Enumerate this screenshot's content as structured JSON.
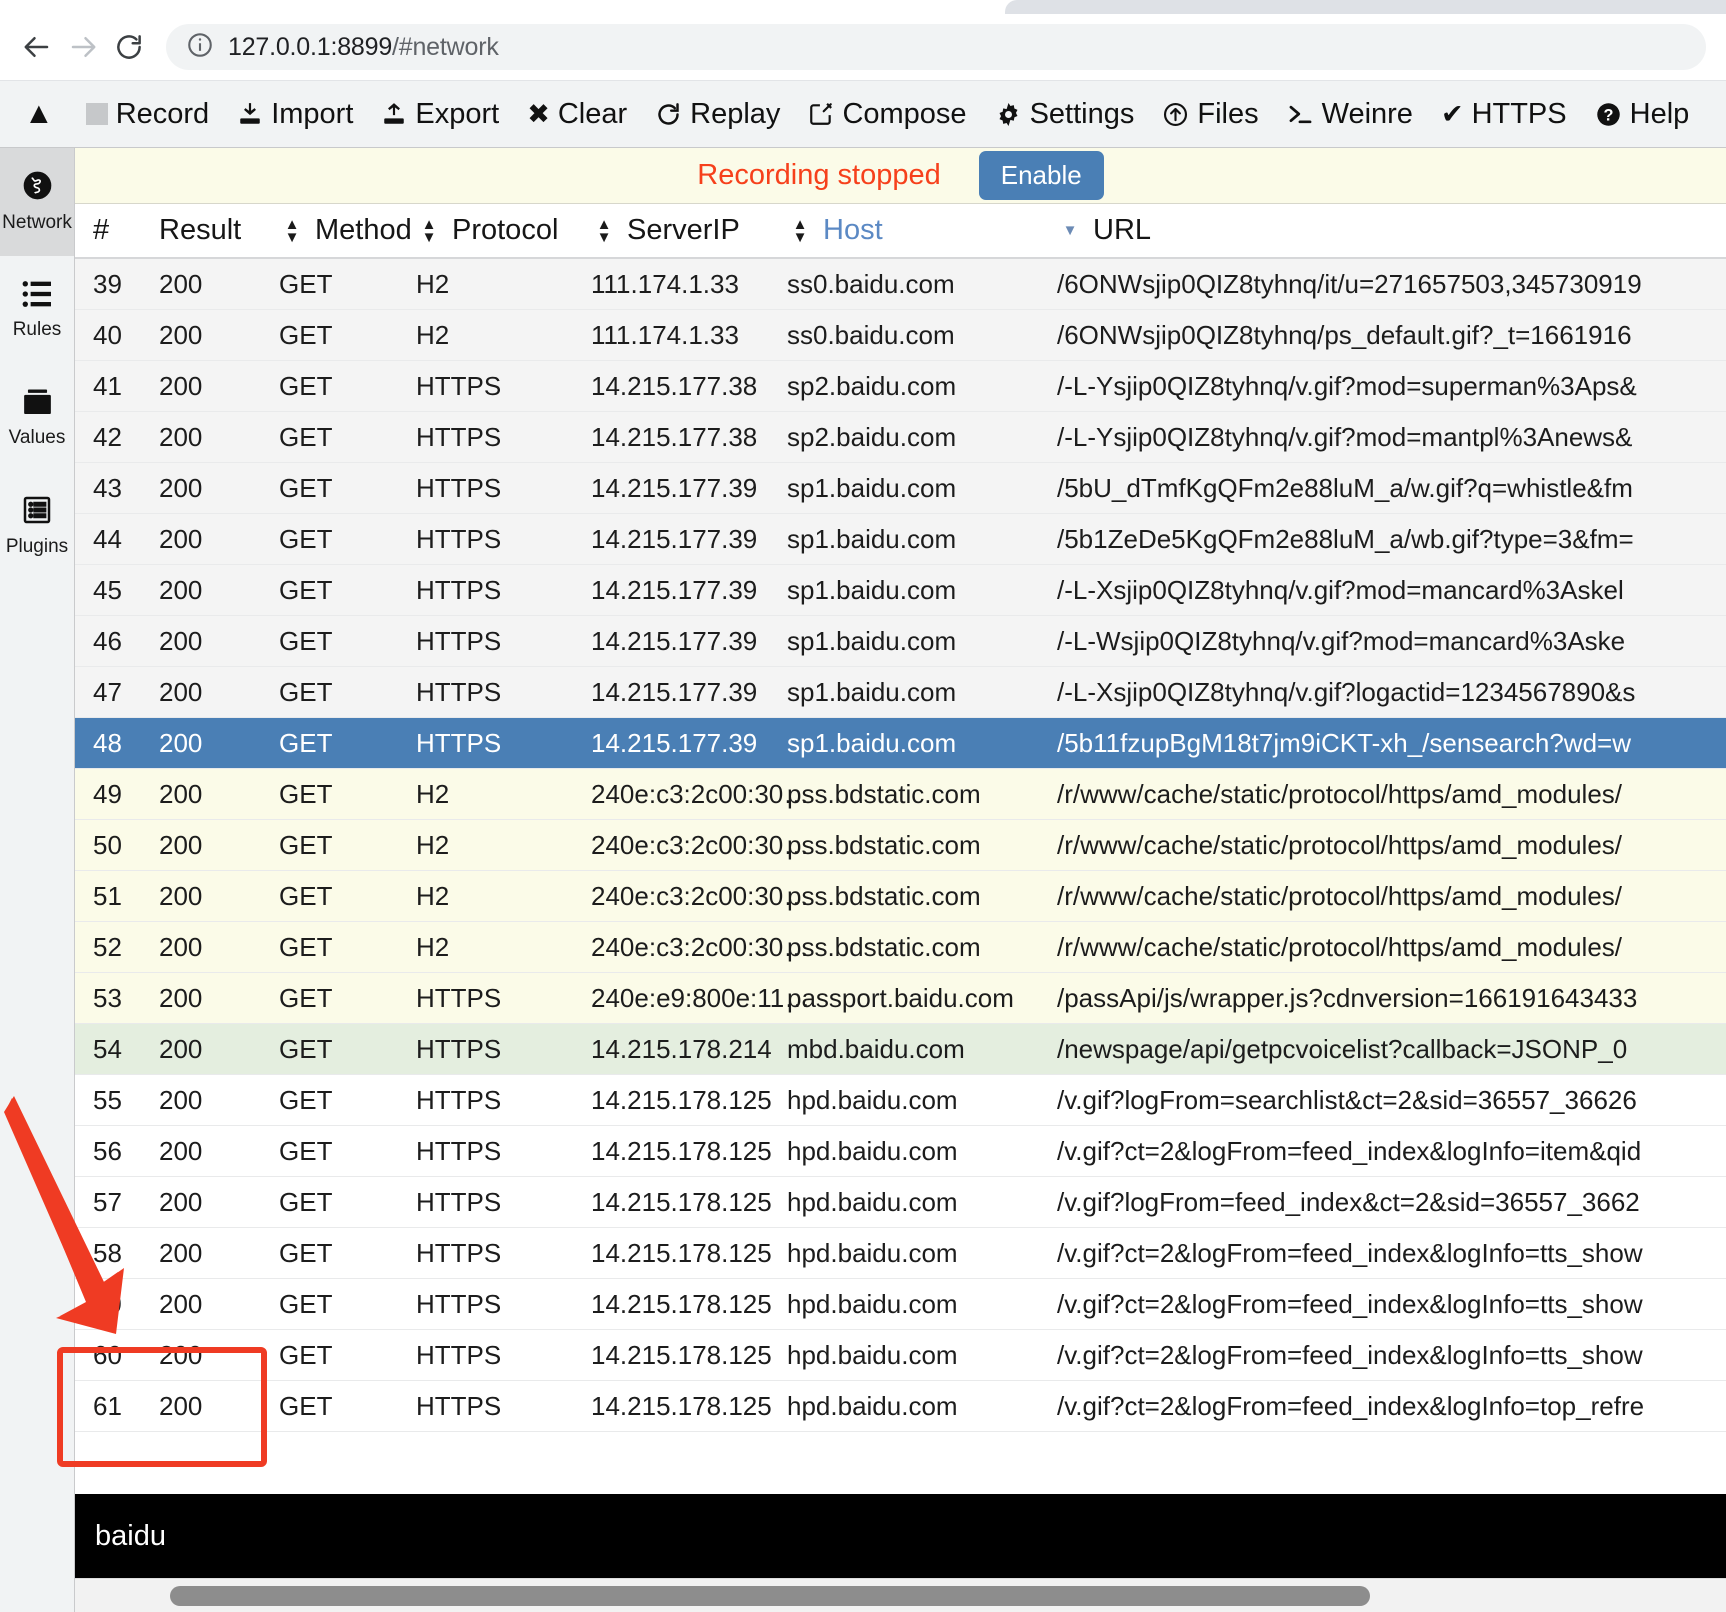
{
  "browser": {
    "back_icon": "back-arrow-icon",
    "forward_icon": "forward-arrow-icon",
    "reload_icon": "reload-icon",
    "info_icon": "site-info-icon",
    "url_main": "127.0.0.1:8899",
    "url_hash": "/#network"
  },
  "toolbar": {
    "collapse_caret": "▲",
    "items": [
      {
        "label": "Record",
        "icon": "stop-square-icon",
        "glyph": ""
      },
      {
        "label": "Import",
        "icon": "import-icon",
        "glyph": "↧"
      },
      {
        "label": "Export",
        "icon": "export-icon",
        "glyph": "↥"
      },
      {
        "label": "Clear",
        "icon": "close-x-icon",
        "glyph": "✖"
      },
      {
        "label": "Replay",
        "icon": "refresh-icon",
        "glyph": "↻"
      },
      {
        "label": "Compose",
        "icon": "compose-pencil-icon",
        "glyph": "✎"
      },
      {
        "label": "Settings",
        "icon": "gear-icon",
        "glyph": "⚙"
      },
      {
        "label": "Files",
        "icon": "upload-circle-icon",
        "glyph": "Ⓔ"
      },
      {
        "label": "Weinre",
        "icon": "terminal-icon",
        "glyph": "❯"
      },
      {
        "label": "HTTPS",
        "icon": "checkmark-icon",
        "glyph": "✔"
      },
      {
        "label": "Help",
        "icon": "question-circle-icon",
        "glyph": "?"
      }
    ]
  },
  "sidebar": {
    "items": [
      {
        "label": "Network",
        "icon": "globe-icon",
        "glyph": "🌐",
        "active": true
      },
      {
        "label": "Rules",
        "icon": "list-icon",
        "glyph": "☰",
        "active": false
      },
      {
        "label": "Values",
        "icon": "folder-icon",
        "glyph": "▬",
        "active": false
      },
      {
        "label": "Plugins",
        "icon": "plugins-icon",
        "glyph": "▤",
        "active": false
      }
    ]
  },
  "banner": {
    "message": "Recording stopped",
    "enable_label": "Enable",
    "message_color": "#f6401b",
    "button_color": "#4a7fb5"
  },
  "table": {
    "columns": [
      {
        "key": "num",
        "label": "#",
        "sortable": false,
        "sorted": false
      },
      {
        "key": "result",
        "label": "Result",
        "sortable": true,
        "sorted": false
      },
      {
        "key": "method",
        "label": "Method",
        "sortable": true,
        "sorted": false
      },
      {
        "key": "protocol",
        "label": "Protocol",
        "sortable": true,
        "sorted": false
      },
      {
        "key": "serverip",
        "label": "ServerIP",
        "sortable": true,
        "sorted": false
      },
      {
        "key": "host",
        "label": "Host",
        "sortable": true,
        "sorted": true
      },
      {
        "key": "url",
        "label": "URL",
        "sortable": false,
        "sorted": false
      }
    ],
    "rows": [
      {
        "num": "39",
        "result": "200",
        "method": "GET",
        "protocol": "H2",
        "serverip": "111.174.1.33",
        "host": "ss0.baidu.com",
        "url": "/6ONWsjip0QIZ8tyhnq/it/u=271657503,345730919",
        "style": "alt"
      },
      {
        "num": "40",
        "result": "200",
        "method": "GET",
        "protocol": "H2",
        "serverip": "111.174.1.33",
        "host": "ss0.baidu.com",
        "url": "/6ONWsjip0QIZ8tyhnq/ps_default.gif?_t=1661916",
        "style": "alt"
      },
      {
        "num": "41",
        "result": "200",
        "method": "GET",
        "protocol": "HTTPS",
        "serverip": "14.215.177.38",
        "host": "sp2.baidu.com",
        "url": "/-L-Ysjip0QIZ8tyhnq/v.gif?mod=superman%3Aps&",
        "style": "alt"
      },
      {
        "num": "42",
        "result": "200",
        "method": "GET",
        "protocol": "HTTPS",
        "serverip": "14.215.177.38",
        "host": "sp2.baidu.com",
        "url": "/-L-Ysjip0QIZ8tyhnq/v.gif?mod=mantpl%3Anews&",
        "style": "alt"
      },
      {
        "num": "43",
        "result": "200",
        "method": "GET",
        "protocol": "HTTPS",
        "serverip": "14.215.177.39",
        "host": "sp1.baidu.com",
        "url": "/5bU_dTmfKgQFm2e88luM_a/w.gif?q=whistle&fm",
        "style": "alt"
      },
      {
        "num": "44",
        "result": "200",
        "method": "GET",
        "protocol": "HTTPS",
        "serverip": "14.215.177.39",
        "host": "sp1.baidu.com",
        "url": "/5b1ZeDe5KgQFm2e88luM_a/wb.gif?type=3&fm=",
        "style": "alt"
      },
      {
        "num": "45",
        "result": "200",
        "method": "GET",
        "protocol": "HTTPS",
        "serverip": "14.215.177.39",
        "host": "sp1.baidu.com",
        "url": "/-L-Xsjip0QIZ8tyhnq/v.gif?mod=mancard%3Askel",
        "style": "alt"
      },
      {
        "num": "46",
        "result": "200",
        "method": "GET",
        "protocol": "HTTPS",
        "serverip": "14.215.177.39",
        "host": "sp1.baidu.com",
        "url": "/-L-Wsjip0QIZ8tyhnq/v.gif?mod=mancard%3Aske",
        "style": "alt"
      },
      {
        "num": "47",
        "result": "200",
        "method": "GET",
        "protocol": "HTTPS",
        "serverip": "14.215.177.39",
        "host": "sp1.baidu.com",
        "url": "/-L-Xsjip0QIZ8tyhnq/v.gif?logactid=1234567890&s",
        "style": "alt"
      },
      {
        "num": "48",
        "result": "200",
        "method": "GET",
        "protocol": "HTTPS",
        "serverip": "14.215.177.39",
        "host": "sp1.baidu.com",
        "url": "/5b11fzupBgM18t7jm9iCKT-xh_/sensearch?wd=w",
        "style": "sel"
      },
      {
        "num": "49",
        "result": "200",
        "method": "GET",
        "protocol": "H2",
        "serverip": "240e:c3:2c00:30…",
        "host": "pss.bdstatic.com",
        "url": "/r/www/cache/static/protocol/https/amd_modules/",
        "style": "cream"
      },
      {
        "num": "50",
        "result": "200",
        "method": "GET",
        "protocol": "H2",
        "serverip": "240e:c3:2c00:30…",
        "host": "pss.bdstatic.com",
        "url": "/r/www/cache/static/protocol/https/amd_modules/",
        "style": "cream"
      },
      {
        "num": "51",
        "result": "200",
        "method": "GET",
        "protocol": "H2",
        "serverip": "240e:c3:2c00:30…",
        "host": "pss.bdstatic.com",
        "url": "/r/www/cache/static/protocol/https/amd_modules/",
        "style": "cream"
      },
      {
        "num": "52",
        "result": "200",
        "method": "GET",
        "protocol": "H2",
        "serverip": "240e:c3:2c00:30…",
        "host": "pss.bdstatic.com",
        "url": "/r/www/cache/static/protocol/https/amd_modules/",
        "style": "cream"
      },
      {
        "num": "53",
        "result": "200",
        "method": "GET",
        "protocol": "HTTPS",
        "serverip": "240e:e9:800e:11…",
        "host": "passport.baidu.com",
        "url": "/passApi/js/wrapper.js?cdnversion=166191643433",
        "style": "cream"
      },
      {
        "num": "54",
        "result": "200",
        "method": "GET",
        "protocol": "HTTPS",
        "serverip": "14.215.178.214",
        "host": "mbd.baidu.com",
        "url": "/newspage/api/getpcvoicelist?callback=JSONP_0",
        "style": "green"
      },
      {
        "num": "55",
        "result": "200",
        "method": "GET",
        "protocol": "HTTPS",
        "serverip": "14.215.178.125",
        "host": "hpd.baidu.com",
        "url": "/v.gif?logFrom=searchlist&ct=2&sid=36557_36626",
        "style": "plain"
      },
      {
        "num": "56",
        "result": "200",
        "method": "GET",
        "protocol": "HTTPS",
        "serverip": "14.215.178.125",
        "host": "hpd.baidu.com",
        "url": "/v.gif?ct=2&logFrom=feed_index&logInfo=item&qid",
        "style": "plain"
      },
      {
        "num": "57",
        "result": "200",
        "method": "GET",
        "protocol": "HTTPS",
        "serverip": "14.215.178.125",
        "host": "hpd.baidu.com",
        "url": "/v.gif?logFrom=feed_index&ct=2&sid=36557_3662",
        "style": "plain"
      },
      {
        "num": "58",
        "result": "200",
        "method": "GET",
        "protocol": "HTTPS",
        "serverip": "14.215.178.125",
        "host": "hpd.baidu.com",
        "url": "/v.gif?ct=2&logFrom=feed_index&logInfo=tts_show",
        "style": "plain"
      },
      {
        "num": "59",
        "result": "200",
        "method": "GET",
        "protocol": "HTTPS",
        "serverip": "14.215.178.125",
        "host": "hpd.baidu.com",
        "url": "/v.gif?ct=2&logFrom=feed_index&logInfo=tts_show",
        "style": "plain"
      },
      {
        "num": "60",
        "result": "200",
        "method": "GET",
        "protocol": "HTTPS",
        "serverip": "14.215.178.125",
        "host": "hpd.baidu.com",
        "url": "/v.gif?ct=2&logFrom=feed_index&logInfo=tts_show",
        "style": "plain"
      },
      {
        "num": "61",
        "result": "200",
        "method": "GET",
        "protocol": "HTTPS",
        "serverip": "14.215.178.125",
        "host": "hpd.baidu.com",
        "url": "/v.gif?ct=2&logFrom=feed_index&logInfo=top_refre",
        "style": "plain"
      }
    ]
  },
  "search": {
    "value": "baidu",
    "placeholder": ""
  },
  "annotations": {
    "arrow_color": "#ef3b23",
    "highlight_box_color": "#ef3b23"
  }
}
